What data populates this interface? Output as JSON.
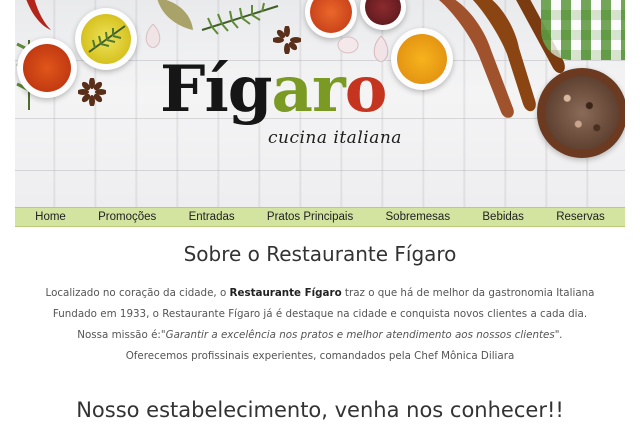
{
  "banner": {
    "logo_part1": "Fíg",
    "logo_part2": "ar",
    "logo_part3": "o",
    "logo_subtitle": "cucina italiana",
    "logo_colors": {
      "black": "#161616",
      "green": "#7a9a24",
      "red": "#c5341f"
    }
  },
  "nav": {
    "background": "#d3e3a0",
    "items": [
      {
        "label": "Home"
      },
      {
        "label": "Promoções"
      },
      {
        "label": "Entradas"
      },
      {
        "label": "Pratos Principais"
      },
      {
        "label": "Sobremesas"
      },
      {
        "label": "Bebidas"
      },
      {
        "label": "Reservas"
      }
    ]
  },
  "about": {
    "title": "Sobre o Restaurante Fígaro",
    "line1_prefix": "Localizado no coração da cidade, o ",
    "line1_strong": "Restaurante Fígaro",
    "line1_suffix": " traz o que há de melhor da gastronomia Italiana",
    "line2": "Fundado em 1933, o Restaurante Fígaro já é destaque na cidade e conquista novos clientes a cada dia.",
    "line3_prefix": "Nossa missão é:",
    "line3_quote": "\"Garantir a excelência nos pratos e melhor atendimento aos nossos clientes\".",
    "line4": "Oferecemos profissinais experientes, comandados pela Chef Mônica Diliara"
  },
  "establishment": {
    "title": "Nosso estabelecimento, venha nos conhecer!!"
  }
}
